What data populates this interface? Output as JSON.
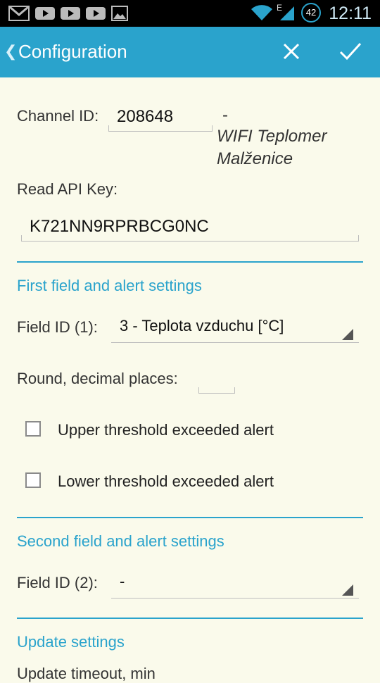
{
  "status_bar": {
    "time": "12:11",
    "battery_level": "42",
    "network_label": "E",
    "icons": [
      "gmail-icon",
      "youtube-icon",
      "youtube-icon",
      "youtube-icon",
      "gallery-icon",
      "wifi-icon",
      "signal-icon",
      "battery-icon"
    ]
  },
  "action_bar": {
    "title": "Configuration",
    "back_icon": "chevron-left-icon",
    "close_icon": "close-icon",
    "confirm_icon": "check-icon",
    "color": "#2aa3cc"
  },
  "channel": {
    "label": "Channel ID:",
    "value": "208648",
    "separator": "-",
    "name_line1": "WIFI Teplomer",
    "name_line2": "Malženice"
  },
  "api_key": {
    "label": "Read API Key:",
    "value": "K721NN9RPRBCG0NC"
  },
  "first_field": {
    "section_title": "First field and alert settings",
    "field_label": "Field ID (1):",
    "field_value": "3 - Teplota vzduchu [°C]",
    "round_label": "Round, decimal places:",
    "round_value": "",
    "upper_alert_label": "Upper threshold exceeded alert",
    "upper_alert_checked": false,
    "lower_alert_label": "Lower threshold exceeded alert",
    "lower_alert_checked": false
  },
  "second_field": {
    "section_title": "Second field and alert settings",
    "field_label": "Field ID (2):",
    "field_value": "-"
  },
  "update": {
    "section_title": "Update settings",
    "timeout_label": "Update timeout, min"
  }
}
